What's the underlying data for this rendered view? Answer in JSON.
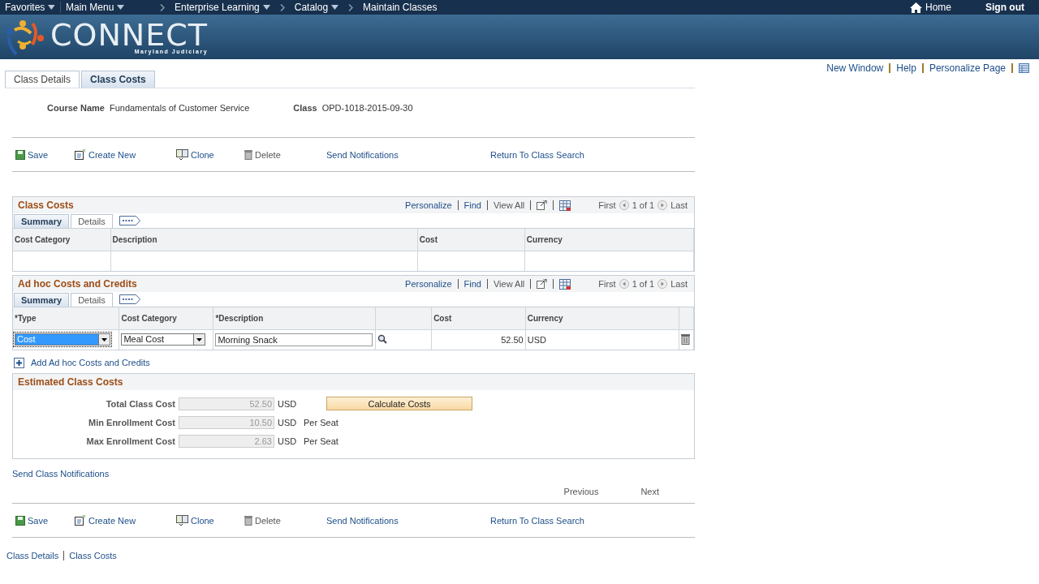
{
  "nav": {
    "items": [
      {
        "label": "Favorites",
        "kind": "menu"
      },
      {
        "label": "Main Menu",
        "kind": "menu"
      },
      {
        "label": "Enterprise Learning",
        "kind": "crumb-menu"
      },
      {
        "label": "Catalog",
        "kind": "crumb-menu"
      },
      {
        "label": "Maintain Classes",
        "kind": "crumb"
      }
    ],
    "home": "Home",
    "signout": "Sign out"
  },
  "banner": {
    "logo": "CONNECT",
    "subtitle": "Maryland Judiciary"
  },
  "page_links": [
    "New Window",
    "Help",
    "Personalize Page"
  ],
  "tabs": [
    {
      "label": "Class Details",
      "selected": false
    },
    {
      "label": "Class Costs",
      "selected": true
    }
  ],
  "header_fields": [
    {
      "label": "Course Name",
      "value": "Fundamentals of Customer Service"
    },
    {
      "label": "Class",
      "value": "OPD-1018-2015-09-30"
    }
  ],
  "toolbar_top": [
    {
      "label": "Save",
      "kind": "save"
    },
    {
      "label": "Create New",
      "kind": "create"
    },
    {
      "label": "Clone",
      "kind": "clone"
    },
    {
      "label": "Delete",
      "kind": "delete"
    },
    {
      "label": "Send Notifications",
      "kind": "link"
    },
    {
      "label": "Return To Class Search",
      "kind": "link"
    }
  ],
  "grids": [
    {
      "title": "Class Costs",
      "nav": {
        "personalize": "Personalize",
        "find": "Find",
        "view_all": "View All",
        "first": "First",
        "count": "1 of 1",
        "last": "Last"
      },
      "subtabs": [
        {
          "label": "Summary",
          "selected": true
        },
        {
          "label": "Details",
          "selected": false
        }
      ],
      "columns": [
        {
          "label": "Cost Category"
        },
        {
          "label": "Description"
        },
        {
          "label": "Cost"
        },
        {
          "label": "Currency"
        }
      ]
    },
    {
      "title": "Ad hoc Costs and Credits",
      "nav": {
        "personalize": "Personalize",
        "find": "Find",
        "view_all": "View All",
        "first": "First",
        "count": "1 of 1",
        "last": "Last"
      },
      "subtabs": [
        {
          "label": "Summary",
          "selected": true
        },
        {
          "label": "Details",
          "selected": false
        }
      ],
      "columns": [
        {
          "label": "*Type",
          "kind": "select"
        },
        {
          "label": "Cost Category",
          "kind": "select"
        },
        {
          "label": "*Description",
          "kind": "input"
        },
        {
          "kind": "lookup"
        },
        {
          "label": "Cost",
          "kind": "number"
        },
        {
          "label": "Currency",
          "kind": "text"
        },
        {
          "kind": "delete"
        }
      ],
      "rows": [
        {
          "cells": [
            "Cost",
            "Meal Cost",
            "Morning Snack",
            "",
            "52.50",
            "USD",
            ""
          ],
          "focused": true
        }
      ]
    }
  ],
  "add_link": "Add Ad hoc Costs and Credits",
  "estimate": {
    "title": "Estimated Class Costs",
    "rows": [
      {
        "label": "Total Class Cost",
        "value": "52.50",
        "unit": "USD"
      },
      {
        "label": "Min Enrollment Cost",
        "value": "10.50",
        "unit": "USD",
        "note": "Per Seat"
      },
      {
        "label": "Max Enrollment Cost",
        "value": "2.63",
        "unit": "USD",
        "note": "Per Seat"
      }
    ],
    "button": "Calculate Costs"
  },
  "send_class_notifications": "Send Class Notifications",
  "pager": [
    "Previous",
    "Next"
  ],
  "toolbar_bottom": [
    {
      "label": "Save",
      "kind": "save"
    },
    {
      "label": "Create New",
      "kind": "create"
    },
    {
      "label": "Clone",
      "kind": "clone"
    },
    {
      "label": "Delete",
      "kind": "delete"
    },
    {
      "label": "Send Notifications",
      "kind": "link"
    },
    {
      "label": "Return To Class Search",
      "kind": "link"
    }
  ],
  "footer_links": [
    "Class Details",
    "Class Costs"
  ]
}
